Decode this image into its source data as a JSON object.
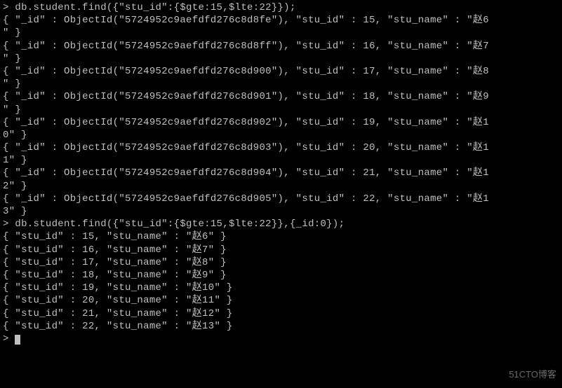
{
  "prompt": ">",
  "cmd1": "db.student.find({\"stu_id\":{$gte:15,$lte:22}});",
  "results1": [
    {
      "id": "5724952c9aefdfd276c8d8fe",
      "stu_id": 15,
      "name": "赵6",
      "extra": ""
    },
    {
      "id": "5724952c9aefdfd276c8d8ff",
      "stu_id": 16,
      "name": "赵7",
      "extra": ""
    },
    {
      "id": "5724952c9aefdfd276c8d900",
      "stu_id": 17,
      "name": "赵8",
      "extra": ""
    },
    {
      "id": "5724952c9aefdfd276c8d901",
      "stu_id": 18,
      "name": "赵9",
      "extra": ""
    },
    {
      "id": "5724952c9aefdfd276c8d902",
      "stu_id": 19,
      "name": "赵1",
      "extra": "0"
    },
    {
      "id": "5724952c9aefdfd276c8d903",
      "stu_id": 20,
      "name": "赵1",
      "extra": "1"
    },
    {
      "id": "5724952c9aefdfd276c8d904",
      "stu_id": 21,
      "name": "赵1",
      "extra": "2"
    },
    {
      "id": "5724952c9aefdfd276c8d905",
      "stu_id": 22,
      "name": "赵1",
      "extra": "3"
    }
  ],
  "cmd2": "db.student.find({\"stu_id\":{$gte:15,$lte:22}},{_id:0});",
  "results2": [
    {
      "stu_id": 15,
      "name": "赵6"
    },
    {
      "stu_id": 16,
      "name": "赵7"
    },
    {
      "stu_id": 17,
      "name": "赵8"
    },
    {
      "stu_id": 18,
      "name": "赵9"
    },
    {
      "stu_id": 19,
      "name": "赵10"
    },
    {
      "stu_id": 20,
      "name": "赵11"
    },
    {
      "stu_id": 21,
      "name": "赵12"
    },
    {
      "stu_id": 22,
      "name": "赵13"
    }
  ],
  "watermark": "51CTO博客"
}
